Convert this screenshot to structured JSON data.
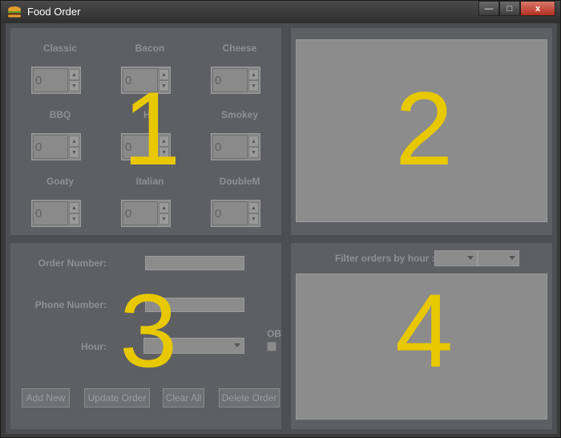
{
  "window": {
    "title": "Food Order",
    "controls": {
      "minimize": "—",
      "maximize": "□",
      "close": "x"
    }
  },
  "panel1": {
    "number": "1",
    "burgers": [
      {
        "label": "Classic",
        "value": "0"
      },
      {
        "label": "Bacon",
        "value": "0"
      },
      {
        "label": "Cheese",
        "value": "0"
      },
      {
        "label": "BBQ",
        "value": "0"
      },
      {
        "label": "Ho",
        "value": "0"
      },
      {
        "label": "Smokey",
        "value": "0"
      },
      {
        "label": "Goaty",
        "value": "0"
      },
      {
        "label": "Italian",
        "value": "0"
      },
      {
        "label": "DoubleM",
        "value": "0"
      }
    ]
  },
  "panel2": {
    "number": "2"
  },
  "panel3": {
    "number": "3",
    "order_number_label": "Order Number:",
    "order_number_value": "",
    "phone_number_label": "Phone Number:",
    "phone_number_value": "",
    "hour_label": "Hour:",
    "hour_value": "",
    "ob_label": "OB",
    "ob_checked": false,
    "buttons": {
      "add_new": "Add New",
      "update_order": "Update Order",
      "clear_all": "Clear All",
      "delete_order": "Delete Order"
    }
  },
  "panel4": {
    "number": "4",
    "filter_label": "Filter orders by hour :",
    "filter_from": "",
    "filter_to": ""
  },
  "colors": {
    "annotation": "#e8c800",
    "panel_bg": "#5d5f63",
    "label_text": "#8e9094",
    "close_button": "#c0392b"
  }
}
